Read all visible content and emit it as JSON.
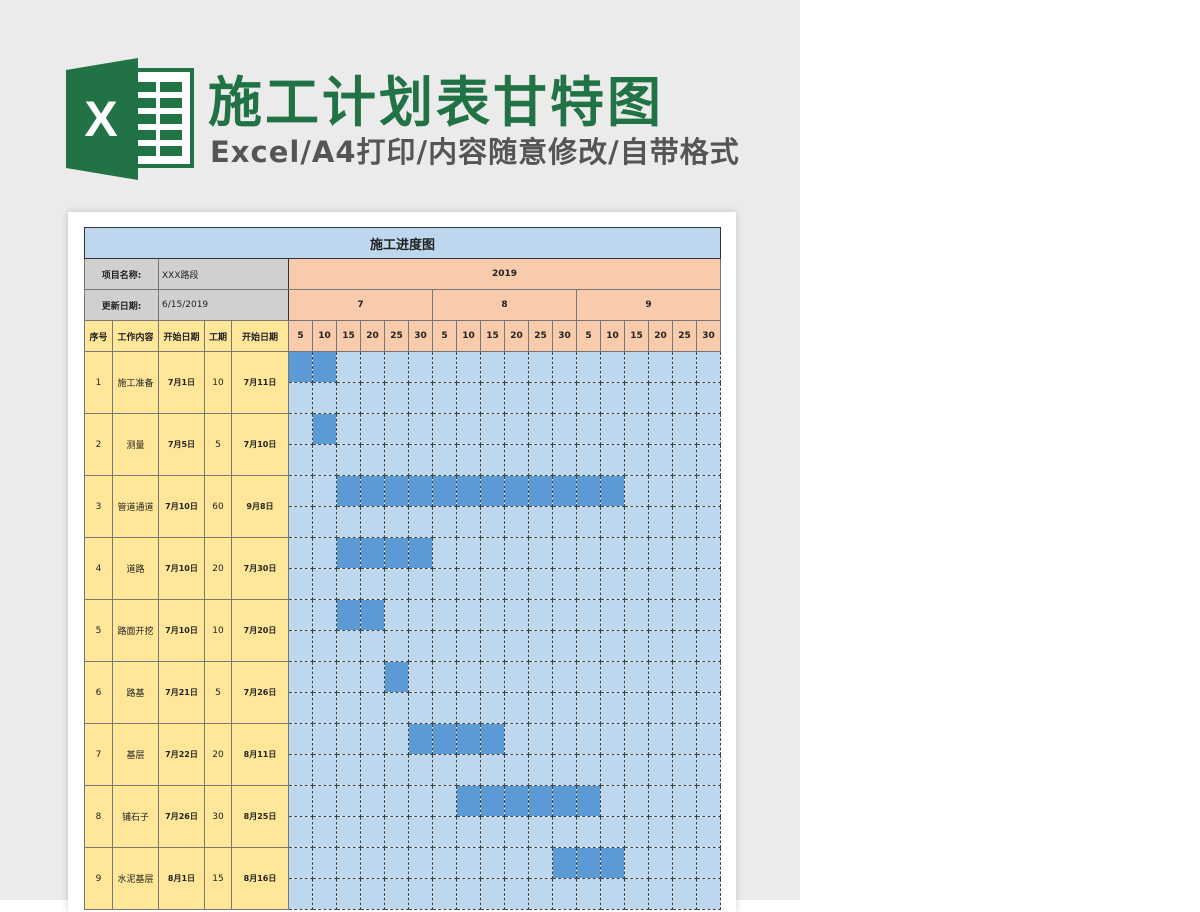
{
  "banner": {
    "title": "施工计划表甘特图",
    "subtitle": "Excel/A4打印/内容随意修改/自带格式",
    "logo_letter": "X",
    "logo_color": "#217346"
  },
  "sheet": {
    "title": "施工进度图",
    "project_label": "项目名称:",
    "project_value": "XXX路段",
    "updated_label": "更新日期:",
    "updated_value": "6/15/2019",
    "year": "2019",
    "months": [
      "7",
      "8",
      "9"
    ],
    "days": [
      "5",
      "10",
      "15",
      "20",
      "25",
      "30",
      "5",
      "10",
      "15",
      "20",
      "25",
      "30",
      "5",
      "10",
      "15",
      "20",
      "25",
      "30"
    ],
    "columns": [
      "序号",
      "工作内容",
      "开始日期",
      "工期",
      "开始日期"
    ],
    "colors": {
      "header_blue": "#bdd7ee",
      "orange": "#f8cbad",
      "yellow": "#ffe699",
      "bar": "#5b9bd5",
      "gray": "#d0d0d0"
    },
    "tasks": [
      {
        "no": "1",
        "name": "施工准备",
        "start": "7月1日",
        "duration": "10",
        "end": "7月11日",
        "bar_start_col": 1,
        "bar_end_col": 2
      },
      {
        "no": "2",
        "name": "测量",
        "start": "7月5日",
        "duration": "5",
        "end": "7月10日",
        "bar_start_col": 2,
        "bar_end_col": 2
      },
      {
        "no": "3",
        "name": "管道通道",
        "start": "7月10日",
        "duration": "60",
        "end": "9月8日",
        "bar_start_col": 3,
        "bar_end_col": 14
      },
      {
        "no": "4",
        "name": "道路",
        "start": "7月10日",
        "duration": "20",
        "end": "7月30日",
        "bar_start_col": 3,
        "bar_end_col": 6
      },
      {
        "no": "5",
        "name": "路面开挖",
        "start": "7月10日",
        "duration": "10",
        "end": "7月20日",
        "bar_start_col": 3,
        "bar_end_col": 4
      },
      {
        "no": "6",
        "name": "路基",
        "start": "7月21日",
        "duration": "5",
        "end": "7月26日",
        "bar_start_col": 5,
        "bar_end_col": 5
      },
      {
        "no": "7",
        "name": "基层",
        "start": "7月22日",
        "duration": "20",
        "end": "8月11日",
        "bar_start_col": 6,
        "bar_end_col": 9
      },
      {
        "no": "8",
        "name": "铺石子",
        "start": "7月26日",
        "duration": "30",
        "end": "8月25日",
        "bar_start_col": 8,
        "bar_end_col": 13
      },
      {
        "no": "9",
        "name": "水泥基层",
        "start": "8月1日",
        "duration": "15",
        "end": "8月16日",
        "bar_start_col": 12,
        "bar_end_col": 14
      }
    ]
  }
}
